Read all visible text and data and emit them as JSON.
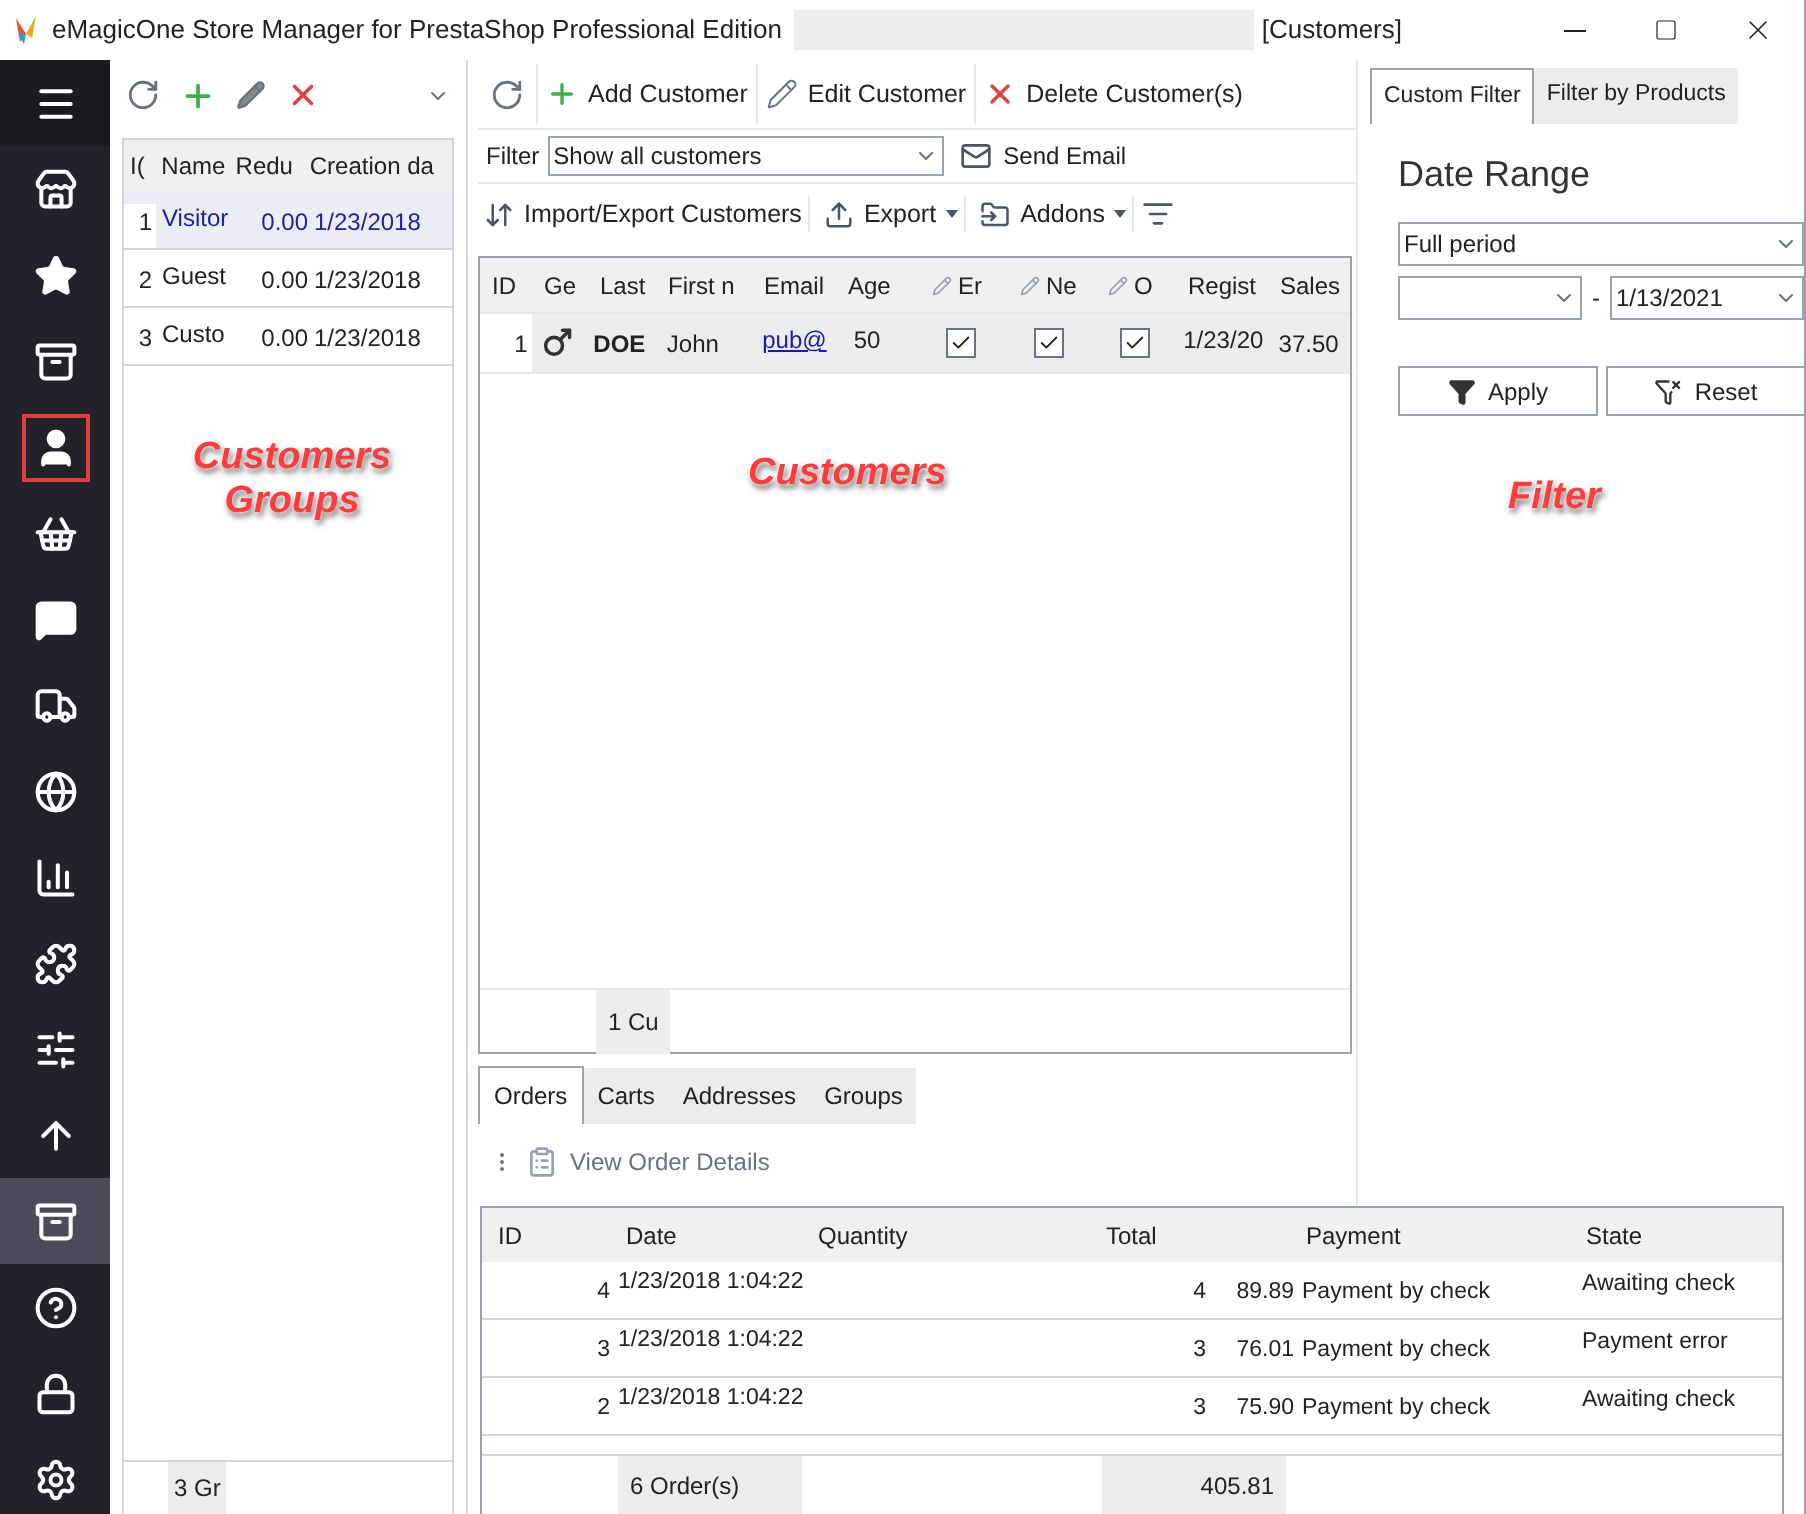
{
  "window": {
    "title": "eMagicOne Store Manager for PrestaShop Professional Edition",
    "subtitle": "[Customers]"
  },
  "sidebar": {
    "items": [
      {
        "selected": false,
        "outlined": false
      },
      {
        "selected": false,
        "outlined": false
      },
      {
        "selected": false,
        "outlined": false
      },
      {
        "selected": false,
        "outlined": false
      },
      {
        "selected": false,
        "outlined": true
      },
      {
        "selected": false,
        "outlined": false
      },
      {
        "selected": false,
        "outlined": false
      },
      {
        "selected": false,
        "outlined": false
      },
      {
        "selected": false,
        "outlined": false
      },
      {
        "selected": false,
        "outlined": false
      },
      {
        "selected": false,
        "outlined": false
      },
      {
        "selected": false,
        "outlined": false
      },
      {
        "selected": false,
        "outlined": false
      },
      {
        "selected": true,
        "outlined": false
      },
      {
        "selected": false,
        "outlined": false
      },
      {
        "selected": false,
        "outlined": false
      },
      {
        "selected": false,
        "outlined": false
      }
    ]
  },
  "groups": {
    "columns": [
      "I(",
      "Name",
      "Redu",
      "Creation da"
    ],
    "rows": [
      {
        "id": "1",
        "name": "Visitor",
        "reduction": "0.00",
        "date": "1/23/2018",
        "selected": true
      },
      {
        "id": "2",
        "name": "Guest",
        "reduction": "0.00",
        "date": "1/23/2018",
        "selected": false
      },
      {
        "id": "3",
        "name": "Custo",
        "reduction": "0.00",
        "date": "1/23/2018",
        "selected": false
      }
    ],
    "footer": "3 Gr",
    "annotation": [
      "Customers",
      "Groups"
    ]
  },
  "customers": {
    "toolbar": [
      "Add Customer",
      "Edit Customer",
      "Delete Customer(s)"
    ],
    "filter": {
      "label": "Filter",
      "value": "Show all customers"
    },
    "send_email": "Send Email",
    "toolbar2": [
      {
        "kind": "button",
        "label": "Import/Export Customers"
      },
      {
        "kind": "menu",
        "label": "Export"
      },
      {
        "kind": "menu",
        "label": "Addons"
      }
    ],
    "columns": [
      {
        "label": "ID",
        "editable": false
      },
      {
        "label": "Ge",
        "editable": false
      },
      {
        "label": "Last",
        "editable": false
      },
      {
        "label": "First n",
        "editable": false
      },
      {
        "label": "Email",
        "editable": false
      },
      {
        "label": "Age",
        "editable": false
      },
      {
        "label": "Er",
        "editable": true
      },
      {
        "label": "Ne",
        "editable": true
      },
      {
        "label": "O",
        "editable": true
      },
      {
        "label": "Regist",
        "editable": false
      },
      {
        "label": "Sales",
        "editable": false
      }
    ],
    "rows": [
      {
        "id": "1",
        "last": "DOE",
        "first": "John",
        "email": "pub@",
        "age": "50",
        "checks": [
          true,
          true,
          true
        ],
        "registered": "1/23/20",
        "sales": "37.50"
      }
    ],
    "footer": "1 Cu",
    "annotation": "Customers"
  },
  "details": {
    "tabs": [
      {
        "label": "Orders",
        "selected": true
      },
      {
        "label": "Carts",
        "selected": false
      },
      {
        "label": "Addresses",
        "selected": false
      },
      {
        "label": "Groups",
        "selected": false
      }
    ],
    "action": "View Order Details",
    "columns": [
      "ID",
      "Date",
      "Quantity",
      "Total",
      "Payment",
      "State"
    ],
    "rows": [
      {
        "id": "4",
        "date": "1/23/2018 1:04:22",
        "quantity": "4",
        "total": "89.89",
        "payment": "Payment by check",
        "state": "Awaiting check"
      },
      {
        "id": "3",
        "date": "1/23/2018 1:04:22",
        "quantity": "3",
        "total": "76.01",
        "payment": "Payment by check",
        "state": "Payment error"
      },
      {
        "id": "2",
        "date": "1/23/2018 1:04:22",
        "quantity": "3",
        "total": "75.90",
        "payment": "Payment by check",
        "state": "Awaiting check"
      }
    ],
    "footer_count": "6 Order(s)",
    "footer_total": "405.81"
  },
  "filter_panel": {
    "tabs": [
      {
        "label": "Custom Filter",
        "selected": true
      },
      {
        "label": "Filter by Products",
        "selected": false
      }
    ],
    "heading": "Date Range",
    "period": "Full period",
    "date_to": "1/13/2021",
    "dash": "-",
    "apply": "Apply",
    "reset": "Reset",
    "annotation": "Filter"
  }
}
